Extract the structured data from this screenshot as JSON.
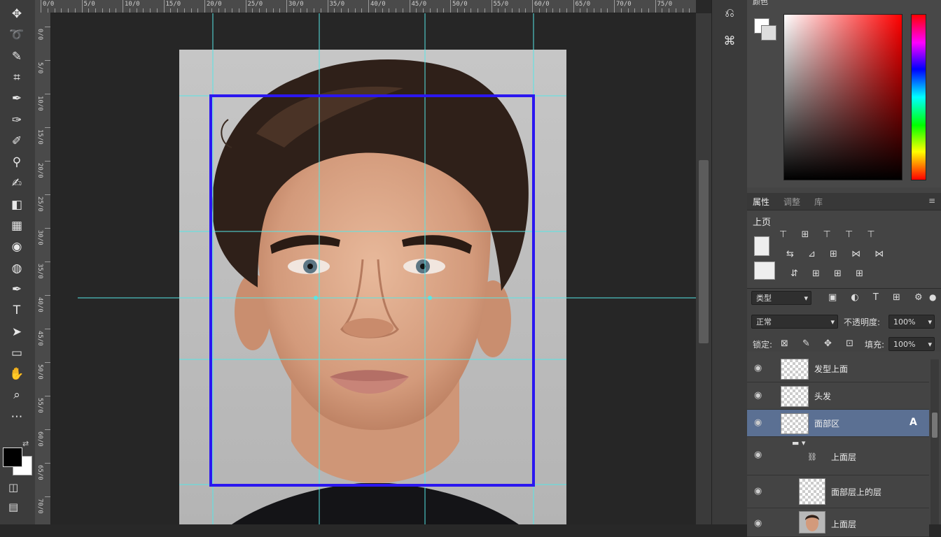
{
  "ruler_top": {
    "labels": [
      "0/0",
      "5/0",
      "10/0",
      "15/0",
      "20/0",
      "25/0",
      "30/0",
      "35/0",
      "40/0",
      "45/0",
      "50/0",
      "55/0",
      "60/0",
      "65/0",
      "70/0",
      "75/0"
    ]
  },
  "ruler_left": {
    "labels": [
      "0/0",
      "5/0",
      "10/0",
      "15/0",
      "20/0",
      "25/0",
      "30/0",
      "35/0",
      "40/0",
      "45/0",
      "50/0",
      "55/0",
      "60/0",
      "65/0",
      "70/0"
    ]
  },
  "toolbar": {
    "tools": [
      {
        "name": "move-tool-icon",
        "glyph": "✥"
      },
      {
        "name": "lasso-tool-icon",
        "glyph": "➰"
      },
      {
        "name": "quick-select-icon",
        "glyph": "✎"
      },
      {
        "name": "crop-tool-icon",
        "glyph": "⌗"
      },
      {
        "name": "eyedropper-icon",
        "glyph": "✒"
      },
      {
        "name": "healing-brush-icon",
        "glyph": "✑"
      },
      {
        "name": "brush-tool-icon",
        "glyph": "✐"
      },
      {
        "name": "clone-stamp-icon",
        "glyph": "⚲"
      },
      {
        "name": "history-brush-icon",
        "glyph": "✍"
      },
      {
        "name": "eraser-icon",
        "glyph": "◧"
      },
      {
        "name": "gradient-icon",
        "glyph": "▦"
      },
      {
        "name": "blur-icon",
        "glyph": "◉"
      },
      {
        "name": "dodge-icon",
        "glyph": "◍"
      },
      {
        "name": "pen-tool-icon",
        "glyph": "✒"
      },
      {
        "name": "type-tool-icon",
        "glyph": "T"
      },
      {
        "name": "path-select-icon",
        "glyph": "➤"
      },
      {
        "name": "shape-tool-icon",
        "glyph": "▭"
      },
      {
        "name": "hand-tool-icon",
        "glyph": "✋"
      },
      {
        "name": "zoom-tool-icon",
        "glyph": "⌕"
      },
      {
        "name": "edit-toolbar-icon",
        "glyph": "⋯"
      }
    ]
  },
  "colors": {
    "foreground": "#000000",
    "background": "#ffffff",
    "guide": "#55e6e6",
    "frame": "#2b17f0"
  },
  "color_panel": {
    "title": "颜色"
  },
  "properties_panel": {
    "tabs": [
      {
        "label": "属性"
      },
      {
        "label": "调整"
      },
      {
        "label": "库"
      }
    ],
    "section": "上页"
  },
  "layers_panel": {
    "kind_filter": "类型",
    "blend_mode": "正常",
    "opacity_label": "不透明度:",
    "opacity_value": "100%",
    "lock_label": "锁定:",
    "fill_label": "填充:",
    "fill_value": "100%",
    "layers": [
      {
        "name": "发型上面"
      },
      {
        "name": "头发"
      },
      {
        "name": "面部区"
      },
      {
        "name": "上面层"
      },
      {
        "name": "面部层上的层"
      },
      {
        "name": "上面层"
      }
    ]
  }
}
